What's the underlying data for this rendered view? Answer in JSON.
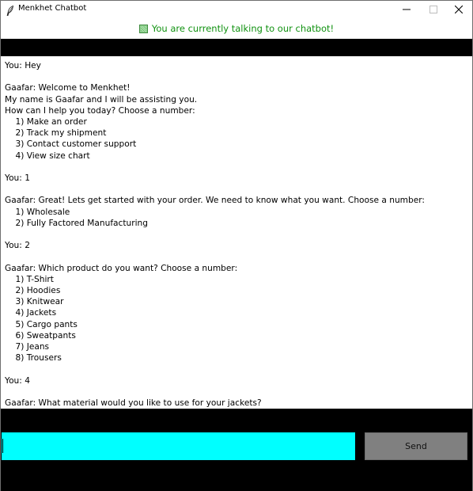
{
  "window": {
    "title": "Menkhet Chatbot",
    "icon": "feather-icon"
  },
  "status": {
    "text": "You are currently talking to our chatbot!",
    "color": "#119211"
  },
  "chat": {
    "transcript": "You: Hey\n\nGaafar: Welcome to Menkhet!\nMy name is Gaafar and I will be assisting you.\nHow can I help you today? Choose a number:\n    1) Make an order\n    2) Track my shipment\n    3) Contact customer support\n    4) View size chart\n\nYou: 1\n\nGaafar: Great! Lets get started with your order. We need to know what you want. Choose a number:\n    1) Wholesale\n    2) Fully Factored Manufacturing\n\nYou: 2\n\nGaafar: Which product do you want? Choose a number:\n    1) T-Shirt\n    2) Hoodies\n    3) Knitwear\n    4) Jackets\n    5) Cargo pants\n    6) Sweatpants\n    7) Jeans\n    8) Trousers\n\nYou: 4\n\nGaafar: What material would you like to use for your jackets?"
  },
  "input": {
    "value": "",
    "background": "#00ffff"
  },
  "send": {
    "label": "Send"
  }
}
